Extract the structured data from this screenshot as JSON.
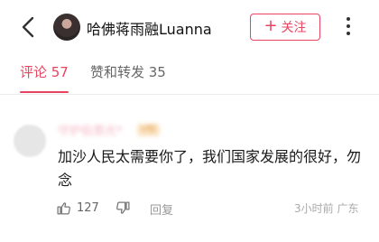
{
  "header": {
    "back_icon": "back-arrow-icon",
    "title": "哈佛蒋雨融Luanna",
    "follow_label": "关注",
    "more_icon": "more-vertical-icon"
  },
  "tabs": [
    {
      "label": "评论 57",
      "active": true
    },
    {
      "label": "赞和转发 35",
      "active": false
    }
  ],
  "comment": {
    "username": "守护伯恩光*",
    "badge": "V标",
    "text": "加沙人民太需要你了，我们国家发展的很好，勿念",
    "likes": "127",
    "reply_label": "回复",
    "time": "3小时前",
    "location": "广东"
  },
  "colors": {
    "accent": "#e8445f",
    "secondary_text": "#999999"
  }
}
